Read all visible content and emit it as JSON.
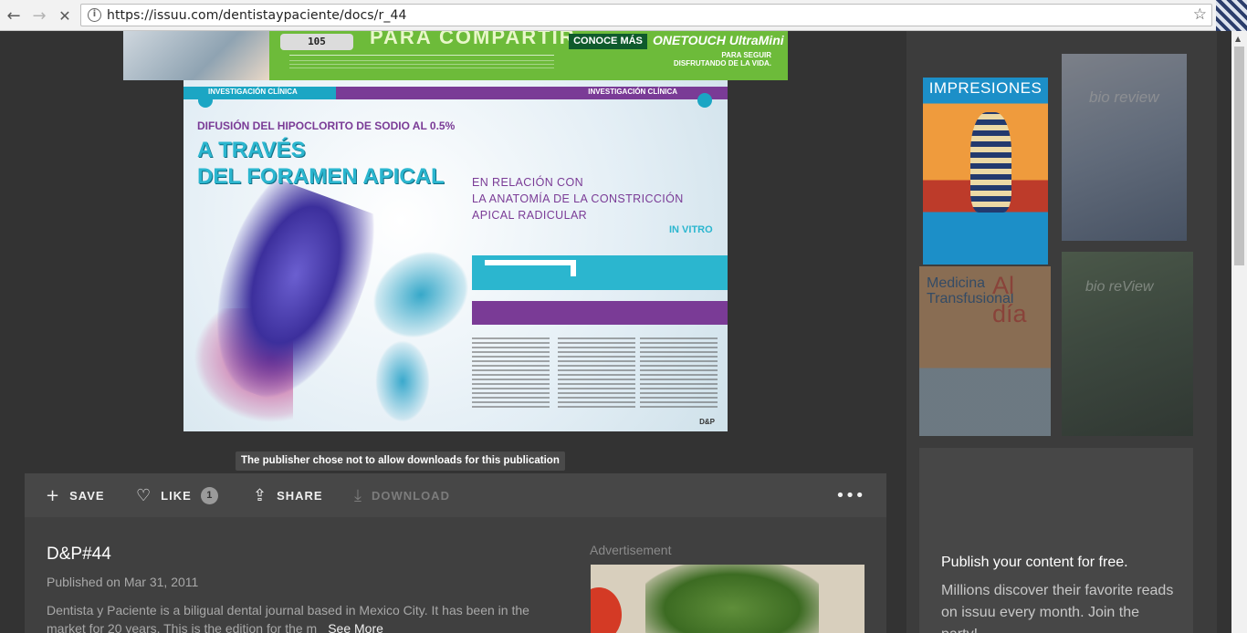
{
  "browser": {
    "url": "https://issuu.com/dentistaypaciente/docs/r_44",
    "back_glyph": "←",
    "forward_glyph": "→",
    "stop_glyph": "✕",
    "star_glyph": "☆",
    "info_glyph": "i"
  },
  "top_ad": {
    "meter_value": "105",
    "headline": "PARA COMPARTIR",
    "cta": "CONOCE MÁS",
    "brand": "ONETOUCH UltraMini",
    "tagline": "PARA SEGUIR DISFRUTANDO DE LA VIDA."
  },
  "document": {
    "section_left": "INVESTIGACIÓN CLÍNICA",
    "section_right": "INVESTIGACIÓN CLÍNICA",
    "subtitle": "DIFUSIÓN DEL HIPOCLORITO DE SODIO AL 0.5%",
    "title_line1": "A TRAVÉS",
    "title_line2": "DEL FORAMEN APICAL",
    "subtitle2_line1": "EN RELACIÓN CON",
    "subtitle2_line2": "LA ANATOMÍA DE LA CONSTRICCIÓN",
    "subtitle2_line3": "APICAL RADICULAR",
    "in_vitro": "IN VITRO",
    "logo": "D&P"
  },
  "tooltip": "The publisher chose not to allow downloads for this publication",
  "actions": {
    "save": "SAVE",
    "like": "LIKE",
    "like_count": "1",
    "share": "SHARE",
    "download": "DOWNLOAD",
    "save_icon": "+",
    "like_icon": "♡",
    "share_icon": "⇪",
    "download_icon": "⤓",
    "more_icon": "•••"
  },
  "publication": {
    "title": "D&P#44",
    "published": "Published on Mar 31, 2011",
    "description": "Dentista y Paciente is a biligual dental journal based in Mexico City. It has been in the market for 20 years. This is the edition for the m",
    "see_more": "See More",
    "ad_label": "Advertisement"
  },
  "related": [
    {
      "title": "IMPRESIONES"
    },
    {
      "title": "bio review"
    },
    {
      "title": "Medicina Transfusional",
      "title2": "Al día"
    },
    {
      "title": "bio reView"
    }
  ],
  "promo": {
    "title": "Publish your content for free.",
    "text": "Millions discover their favorite reads on issuu every month. Join the party!"
  }
}
